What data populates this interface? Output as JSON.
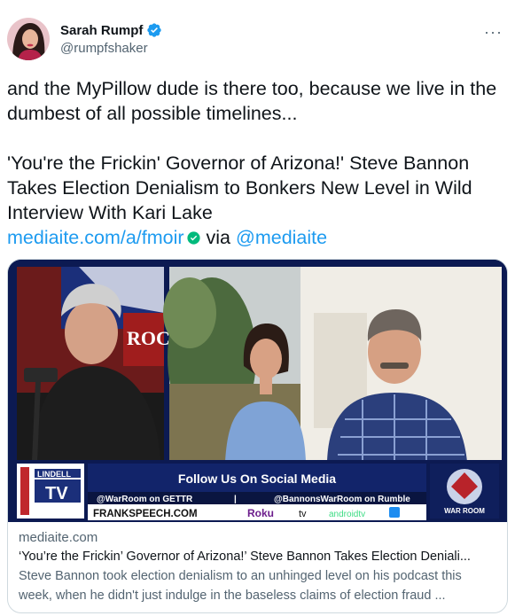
{
  "author": {
    "display_name": "Sarah Rumpf",
    "handle": "@rumpfshaker"
  },
  "more_label": "···",
  "tweet": {
    "line1": "and the MyPillow dude is there too, because we live in the dumbest of all possible timelines...",
    "line2": "'You're the Frickin' Governor of Arizona!' Steve Bannon Takes Election Denialism to Bonkers New Level in Wild Interview With Kari Lake",
    "link": "mediaite.com/a/fmoir",
    "via_word": "via",
    "mention": "@mediaite"
  },
  "media": {
    "banner_title": "Follow Us On Social Media",
    "banner_left": "@WarRoom on GETTR",
    "banner_sep": "|",
    "banner_right": "@BannonsWarRoom on Rumble",
    "banner_site": "FRANKSPEECH.COM",
    "banner_roku": "Roku",
    "banner_tv": "tv",
    "banner_android": "androidtv",
    "lindell_top": "LINDELL",
    "lindell_tv": "TV",
    "warroom_logo": "WAR ROOM",
    "backdrop_letters": "ROC"
  },
  "card": {
    "domain": "mediaite.com",
    "title": "‘You’re the Frickin’ Governor of Arizona!’ Steve Bannon Takes Election Deniali...",
    "description": "Steve Bannon took election denialism to an unhinged level on his podcast this week, when he didn't just indulge in the baseless claims of election fraud ..."
  },
  "colors": {
    "link": "#1d9bf0",
    "verified": "#1d9bf0",
    "text": "#0f1419",
    "secondary": "#536471",
    "banner_navy": "#0c1a52"
  }
}
